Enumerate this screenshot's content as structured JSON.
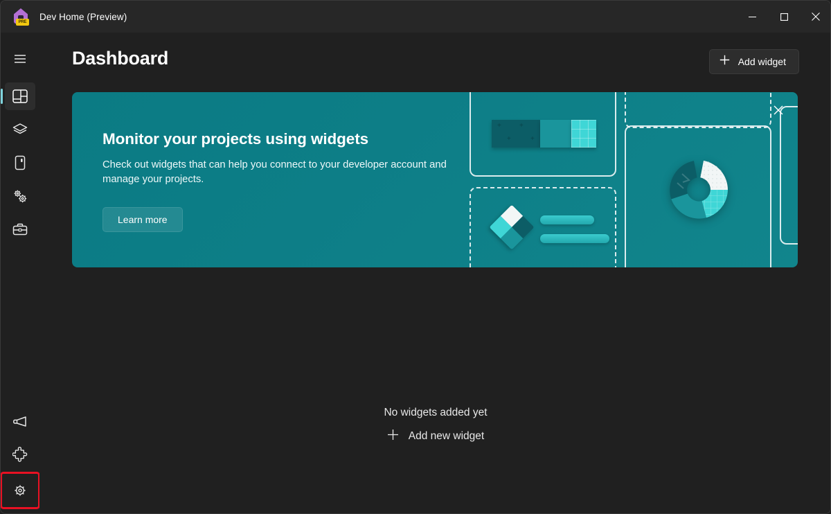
{
  "window": {
    "app_icon_name": "dev-home-app-icon",
    "app_icon_badge": "PRE",
    "title": "Dev Home (Preview)",
    "controls": [
      {
        "name": "minimize-button",
        "glyph": "minimize"
      },
      {
        "name": "maximize-button",
        "glyph": "maximize"
      },
      {
        "name": "close-button",
        "glyph": "close"
      }
    ]
  },
  "sidebar": {
    "hamburger": {
      "label": "Navigation menu",
      "icon": "hamburger-menu-icon"
    },
    "items": [
      {
        "label": "Dashboard",
        "icon": "dashboard-icon",
        "selected": true
      },
      {
        "label": "Machine configuration",
        "icon": "layers-icon",
        "selected": false
      },
      {
        "label": "Utilities",
        "icon": "device-icon",
        "selected": false
      },
      {
        "label": "Environments",
        "icon": "gears-icon",
        "selected": false
      },
      {
        "label": "Toolkit",
        "icon": "briefcase-icon",
        "selected": false
      }
    ],
    "bottom_items": [
      {
        "label": "Send feedback",
        "icon": "megaphone-icon",
        "highlighted": false
      },
      {
        "label": "Extensions",
        "icon": "puzzle-piece-icon",
        "highlighted": false
      },
      {
        "label": "Settings",
        "icon": "gear-icon",
        "highlighted": true
      }
    ],
    "highlight_color": "#e81123",
    "selected_indicator_color": "#7fd4dd"
  },
  "main": {
    "page_title": "Dashboard",
    "add_widget_button": {
      "label": "Add widget",
      "icon": "plus-icon"
    },
    "banner": {
      "title": "Monitor your projects using widgets",
      "description": "Check out widgets that can help you connect to your developer account and manage your projects.",
      "learn_more_label": "Learn more",
      "close_icon": "close-icon",
      "background_color": "#0d7e87",
      "illustration": {
        "name": "widgets-illustration",
        "elements": [
          "widget-card-outline",
          "widget-card-dashed-outline",
          "bar-widget",
          "diamond-widget",
          "donut-chart-widget"
        ]
      }
    },
    "empty_state": {
      "title": "No widgets added yet",
      "add_label": "Add new widget",
      "add_icon": "plus-icon"
    }
  }
}
